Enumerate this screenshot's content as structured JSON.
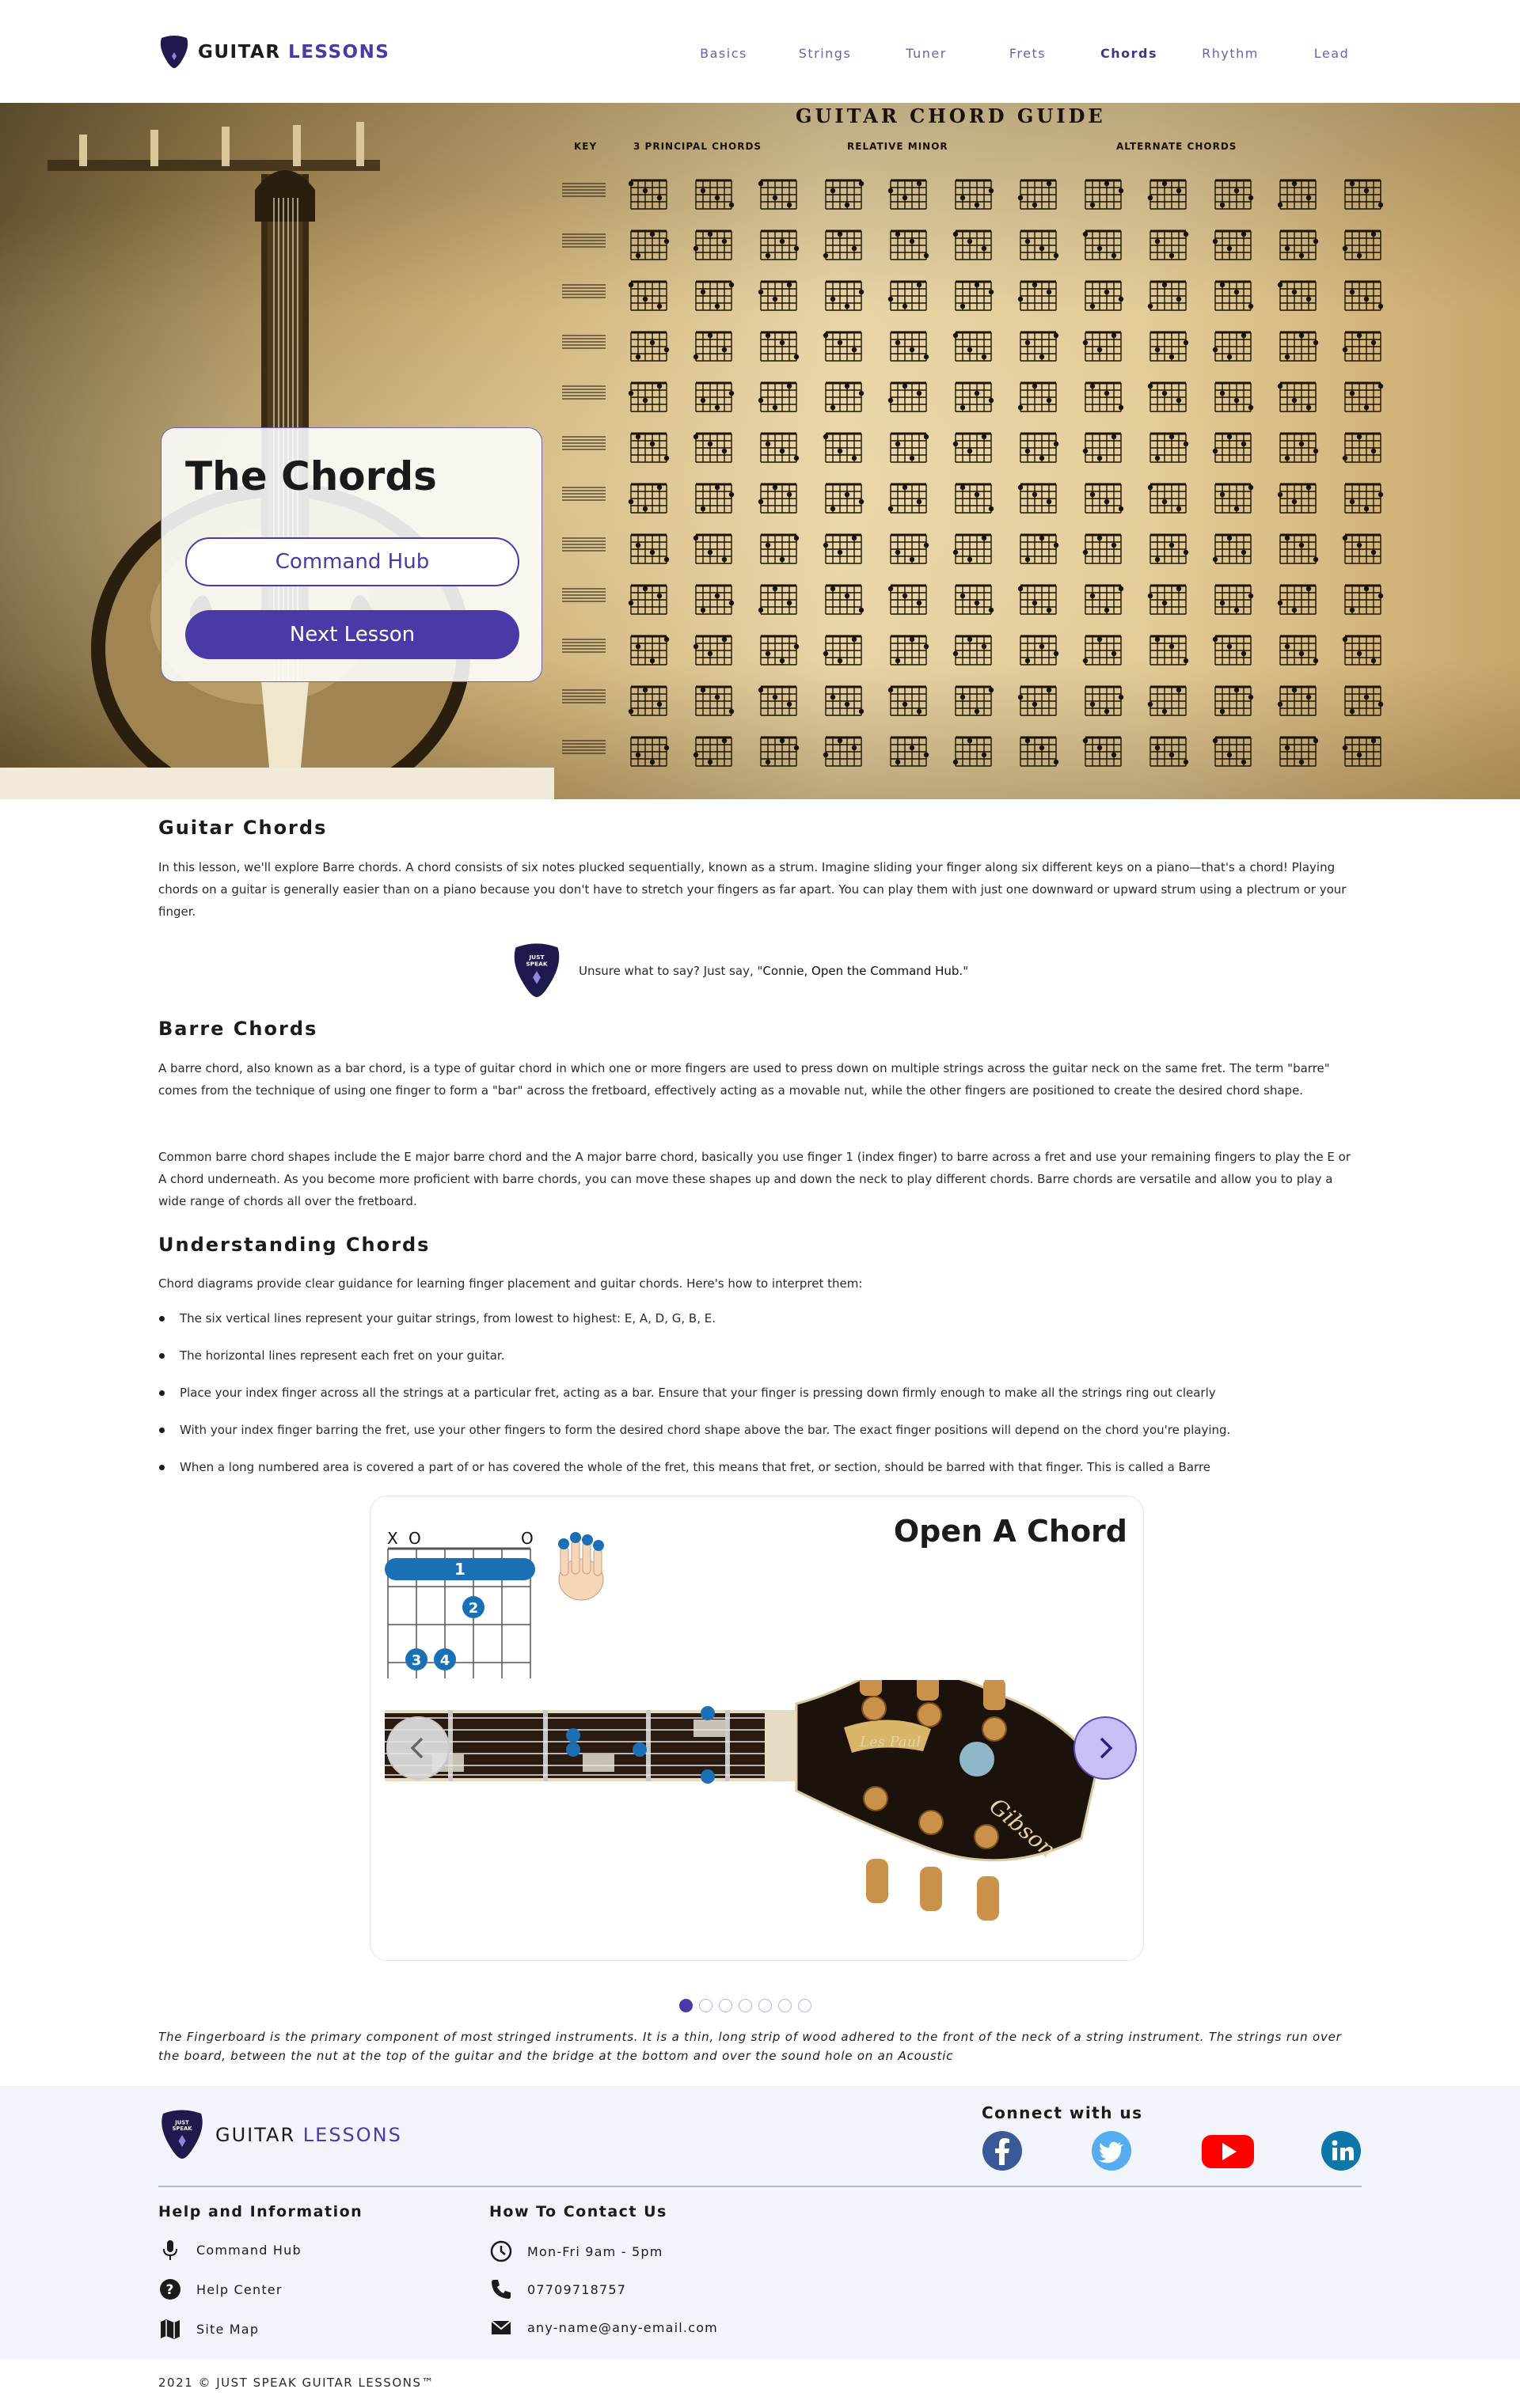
{
  "header": {
    "logo_word1": "GUITAR",
    "logo_word2": "LESSONS",
    "nav": [
      {
        "label": "Basics"
      },
      {
        "label": "Strings"
      },
      {
        "label": "Tuner"
      },
      {
        "label": "Frets"
      },
      {
        "label": "Chords",
        "active": true
      },
      {
        "label": "Rhythm"
      },
      {
        "label": "Lead"
      }
    ]
  },
  "hero": {
    "chart_title": "GUITAR CHORD GUIDE",
    "chart_columns": [
      "KEY",
      "3 PRINCIPAL CHORDS",
      "RELATIVE MINOR",
      "ALTERNATE CHORDS"
    ],
    "title": "The Chords",
    "command_hub_button": "Command Hub",
    "next_lesson_button": "Next Lesson"
  },
  "logo_pick_text": [
    "JUST",
    "SPEAK"
  ],
  "content": {
    "guitar_chords_heading": "Guitar Chords",
    "guitar_chords_text": "In this lesson, we'll explore Barre chords. A chord consists of six notes plucked sequentially, known as a strum. Imagine sliding your finger along six different keys on a piano—that's a chord! Playing chords on a guitar is generally easier than on a piano because you don't have to stretch your fingers as far apart. You can play them with just one downward or upward strum using a plectrum or your finger.",
    "tip_prefix": "Unsure what to say? Just say, \"",
    "tip_phrase": "Connie, Open the Command Hub.",
    "tip_suffix": "\"",
    "barre_heading": "Barre Chords",
    "barre_text_1": "A barre chord, also known as a bar chord, is a type of guitar chord in which one or more fingers are used to press down on multiple strings across the guitar neck on the same fret. The term \"barre\" comes from the technique of using one finger to form a \"bar\" across the fretboard, effectively acting as a movable nut, while the other fingers are positioned to create the desired chord shape.",
    "barre_text_2": "Common barre chord shapes include the E major barre chord and the A major barre chord, basically you use finger 1 (index finger) to barre across a fret and use your remaining fingers to play the E or A chord underneath. As you become more proficient with barre chords, you can move these shapes up and down the neck to play different chords. Barre chords are versatile and allow you to play a wide range of chords all over the fretboard.",
    "understanding_heading": "Understanding Chords",
    "understanding_intro": "Chord diagrams provide clear guidance for learning finger placement and guitar chords. Here's how to interpret them:",
    "bullets": [
      "The six vertical lines represent your guitar strings, from lowest to highest: E, A, D, G, B, E.",
      "The horizontal lines represent each fret on your guitar.",
      "Place your index finger across all the strings at a particular fret, acting as a bar. Ensure that your finger is pressing down firmly enough to make all the strings ring out clearly",
      "With your index finger barring the fret, use your other fingers to form the desired chord shape above the bar. The exact finger positions will depend on the chord you're playing.",
      "When a long numbered area is covered a part of or has covered the whole of the fret, this means that fret, or section, should be barred with that finger. This is called a Barre"
    ]
  },
  "carousel": {
    "title": "Open A Chord",
    "string_markers": [
      "X",
      "O",
      "O"
    ],
    "fingers": [
      "1",
      "2",
      "3",
      "4"
    ],
    "brand": "Gibson",
    "model": "Les Paul",
    "slides_total": 7,
    "active_slide": 1,
    "prev_icon": "chevron-left-icon",
    "next_icon": "chevron-right-icon"
  },
  "caption": "The Fingerboard is the primary component of most stringed instruments. It is a thin, long strip of wood adhered to the front of the neck of a string instrument. The strings run over the board, between the nut at the top of the guitar and the bridge at the bottom and over the sound hole on an Acoustic",
  "footer": {
    "logo_word1": "GUITAR",
    "logo_word2": "LESSONS",
    "connect_heading": "Connect with us",
    "social": [
      {
        "name": "facebook-icon",
        "color": "#3b5998"
      },
      {
        "name": "twitter-icon",
        "color": "#55acee"
      },
      {
        "name": "youtube-icon",
        "color": "#ff0000"
      },
      {
        "name": "linkedin-icon",
        "color": "#0e76a8"
      }
    ],
    "help_heading": "Help and Information",
    "help_items": [
      "Command Hub",
      "Help Center",
      "Site Map"
    ],
    "contact_heading": "How To Contact Us",
    "contact_items": [
      "Mon-Fri 9am - 5pm",
      "07709718757",
      "any-name@any-email.com"
    ],
    "copyright": "2021 © JUST SPEAK GUITAR LESSONS™"
  },
  "colors": {
    "accent": "#4a3aa8",
    "nav_text": "#6a64a8",
    "footer_bg": "#f1f4fb",
    "chord_blue": "#1a6fb5"
  }
}
